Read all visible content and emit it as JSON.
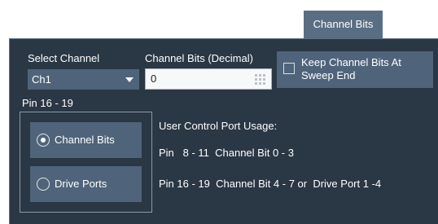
{
  "tab": {
    "label": "Channel Bits"
  },
  "select_channel": {
    "label": "Select Channel",
    "value": "Ch1"
  },
  "channel_bits": {
    "label": "Channel Bits (Decimal)",
    "value": "0"
  },
  "keep_bits": {
    "label_line1": "Keep Channel Bits At",
    "label_line2": "Sweep End",
    "checked": false
  },
  "pin_group": {
    "label": "Pin 16 - 19",
    "options": [
      {
        "label": "Channel Bits",
        "selected": true
      },
      {
        "label": "Drive Ports",
        "selected": false
      }
    ]
  },
  "usage": {
    "title": "User Control Port Usage:",
    "line1": "Pin   8 - 11  Channel Bit 0 - 3",
    "line2": "Pin 16 - 19  Channel Bit 4 - 7 or  Drive Port 1 -4"
  },
  "colors": {
    "panel_bg": "#2a3744",
    "control_bg": "#4f647a",
    "tab_bg": "#5a6e83",
    "text": "#ffffff"
  }
}
